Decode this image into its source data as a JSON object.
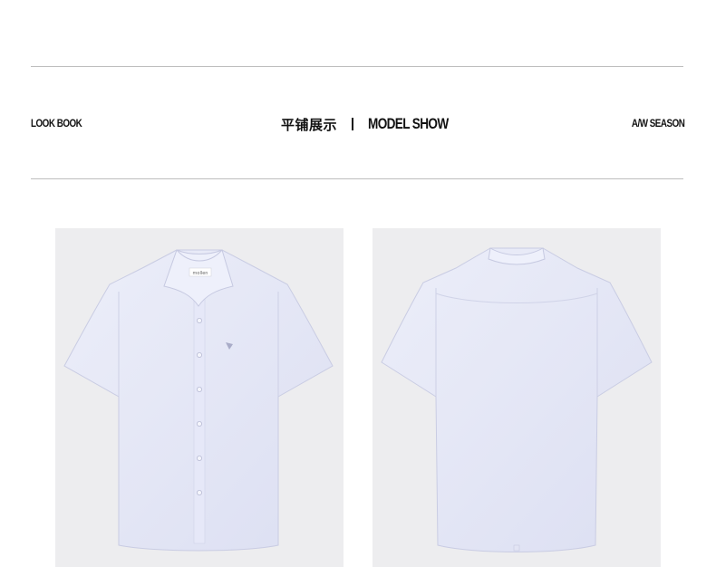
{
  "header": {
    "left_label": "LOOK BOOK",
    "title_cn": "平铺展示",
    "separator": "|",
    "title_en": "MODEL SHOW",
    "right_label": "A/W SEASON"
  },
  "colors": {
    "shirt": "#e3e4f5",
    "photo_background": "#ededef",
    "rule": "#bdbdbd"
  },
  "gallery": {
    "items": [
      {
        "view": "front",
        "collar_tag_text": "mollen"
      },
      {
        "view": "back"
      }
    ]
  }
}
